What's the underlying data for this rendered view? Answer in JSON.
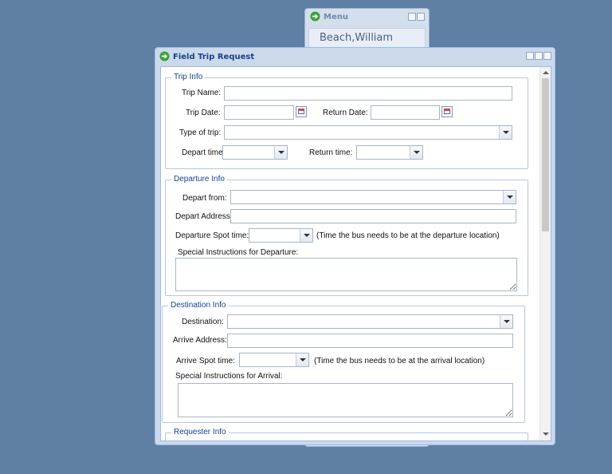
{
  "menu_window": {
    "title": "Menu",
    "user_name": "Beach,William"
  },
  "main_window": {
    "title": "Field Trip Request"
  },
  "trip_info": {
    "legend": "Trip Info",
    "trip_name_label": "Trip Name:",
    "trip_name_value": "",
    "trip_date_label": "Trip Date:",
    "trip_date_value": "",
    "return_date_label": "Return Date:",
    "return_date_value": "",
    "type_of_trip_label": "Type of trip:",
    "type_of_trip_value": "",
    "depart_time_label": "Depart time:",
    "depart_time_value": "",
    "return_time_label": "Return time:",
    "return_time_value": ""
  },
  "departure_info": {
    "legend": "Departure Info",
    "depart_from_label": "Depart from:",
    "depart_from_value": "",
    "depart_address_label": "Depart Address:",
    "depart_address_value": "",
    "spot_time_label": "Departure Spot time:",
    "spot_time_value": "",
    "spot_time_hint": "(Time the bus needs to be at the departure location)",
    "instructions_label": "Special Instructions for Departure:",
    "instructions_value": ""
  },
  "destination_info": {
    "legend": "Destination Info",
    "destination_label": "Destination:",
    "destination_value": "",
    "arrive_address_label": "Arrive Address:",
    "arrive_address_value": "",
    "spot_time_label": "Arrive Spot time:",
    "spot_time_value": "",
    "spot_time_hint": "(Time the bus needs to be at the arrival location)",
    "instructions_label": "Special Instructions for Arrival:",
    "instructions_value": ""
  },
  "requester_info": {
    "legend": "Requester Info"
  },
  "colors": {
    "desktop": "#5f7fa4",
    "title_text": "#15428b",
    "window_frame": "#ccd9ea"
  },
  "icons": [
    "go-arrow-icon",
    "minimize-icon",
    "maximize-icon",
    "close-icon",
    "calendar-icon",
    "chevron-down-icon"
  ]
}
